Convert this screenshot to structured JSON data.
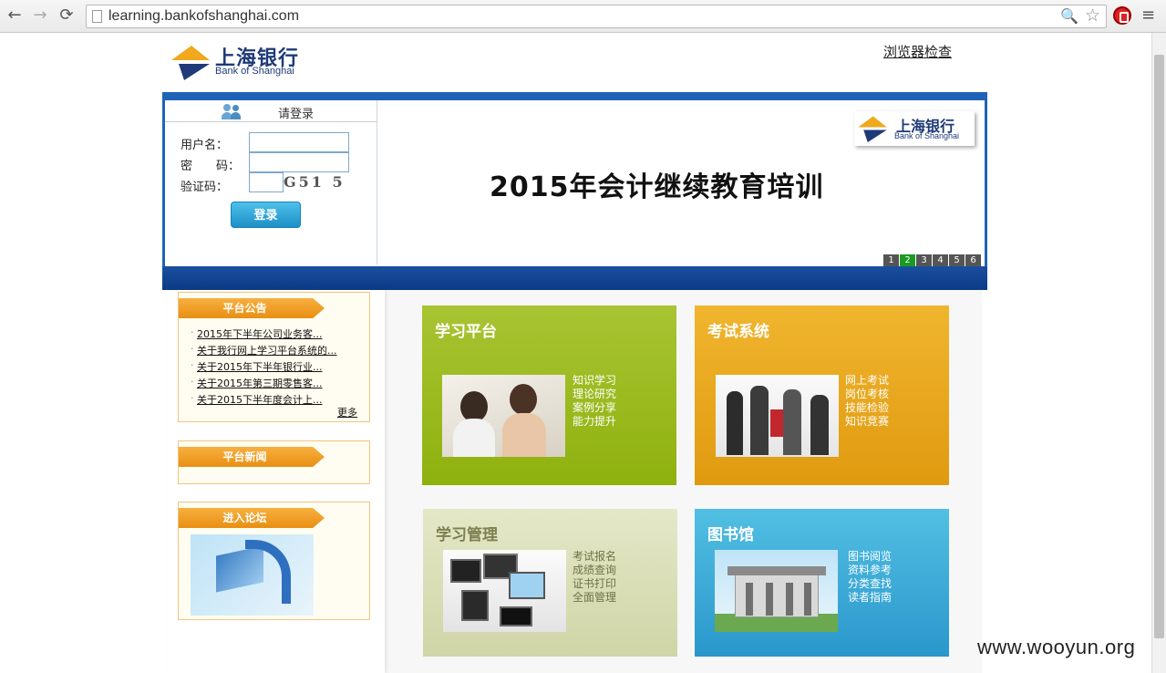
{
  "browser": {
    "url": "learning.bankofshanghai.com",
    "back_icon": "arrow-left",
    "forward_icon": "arrow-right",
    "reload_icon": "reload",
    "back_glyph": "←",
    "forward_glyph": "→",
    "reload_glyph": "⟳",
    "zoom_glyph": "🔍",
    "star_glyph": "☆",
    "menu_glyph": "≡"
  },
  "header": {
    "logo_cn": "上海银行",
    "logo_en": "Bank of Shanghai",
    "browser_check": "浏览器检查"
  },
  "login": {
    "title": "请登录",
    "username_label": "用户名：",
    "password_label": "密　　码：",
    "captcha_label": "验证码：",
    "captcha_text": "G51 5",
    "username_value": "",
    "password_value": "",
    "captcha_value": "",
    "submit": "登录"
  },
  "banner": {
    "logo_cn": "上海银行",
    "logo_en": "Bank of Shanghai",
    "title": "2015年会计继续教育培训",
    "pages": [
      "1",
      "2",
      "3",
      "4",
      "5",
      "6"
    ],
    "active_page": "2"
  },
  "announcements": {
    "title": "平台公告",
    "items": [
      "2015年下半年公司业务客...",
      "关于我行网上学习平台系统的...",
      "关于2015年下半年银行业...",
      "关于2015年第三期零售客...",
      "关于2015下半年度会计上..."
    ],
    "more": "更多"
  },
  "news": {
    "title": "平台新闻"
  },
  "forum": {
    "title": "进入论坛"
  },
  "tiles": {
    "study": {
      "title": "学习平台",
      "lines": [
        "知识学习",
        "理论研究",
        "案例分享",
        "能力提升"
      ]
    },
    "exam": {
      "title": "考试系统",
      "lines": [
        "网上考试",
        "岗位考核",
        "技能检验",
        "知识竞赛"
      ]
    },
    "manage": {
      "title": "学习管理",
      "lines": [
        "考试报名",
        "成绩查询",
        "证书打印",
        "全面管理"
      ]
    },
    "library": {
      "title": "图书馆",
      "lines": [
        "图书阅览",
        "资料参考",
        "分类查找",
        "读者指南"
      ]
    }
  },
  "watermark": "www.wooyun.org",
  "colors": {
    "frame_blue": "#1f63b8",
    "tile_green": "#9bba1f",
    "tile_orange": "#e8a61e",
    "tile_sage": "#d9deb6",
    "tile_blue": "#3aa9d6",
    "ribbon_orange": "#ee9c22",
    "active_page": "#1b9a22"
  }
}
